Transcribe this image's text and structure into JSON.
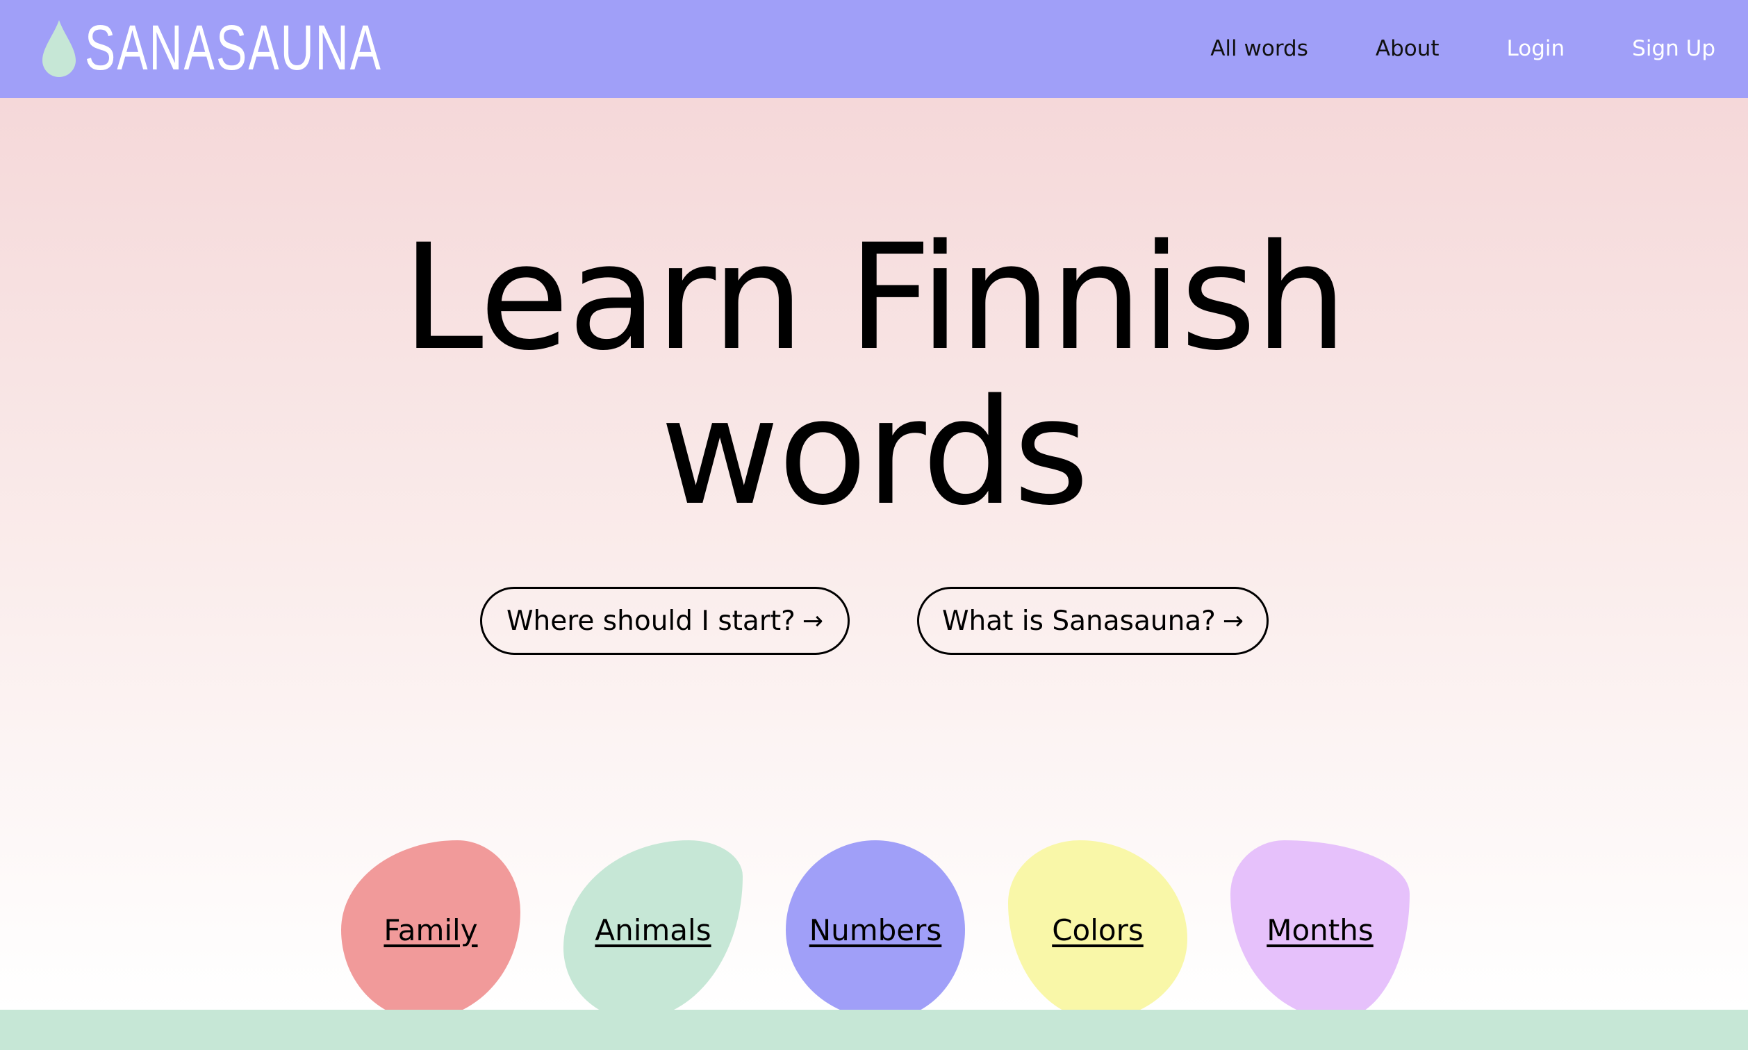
{
  "brand": {
    "name": "SANASAUNA"
  },
  "nav": {
    "all_words": "All words",
    "about": "About",
    "login": "Login",
    "signup": "Sign Up"
  },
  "hero": {
    "line1": "Learn Finnish",
    "line2": "words",
    "cta_start": "Where should I start?",
    "cta_about": "What is Sanasauna?",
    "arrow": "→"
  },
  "categories": [
    {
      "label": "Family",
      "color": "#f19a9a"
    },
    {
      "label": "Animals",
      "color": "#c6e7d6"
    },
    {
      "label": "Numbers",
      "color": "#a09ff8"
    },
    {
      "label": "Colors",
      "color": "#f9f7a8"
    },
    {
      "label": "Months",
      "color": "#e6c1fb"
    }
  ],
  "colors": {
    "header": "#a09ff8",
    "drop": "#c6e7d6",
    "footer": "#c6e7d6"
  }
}
